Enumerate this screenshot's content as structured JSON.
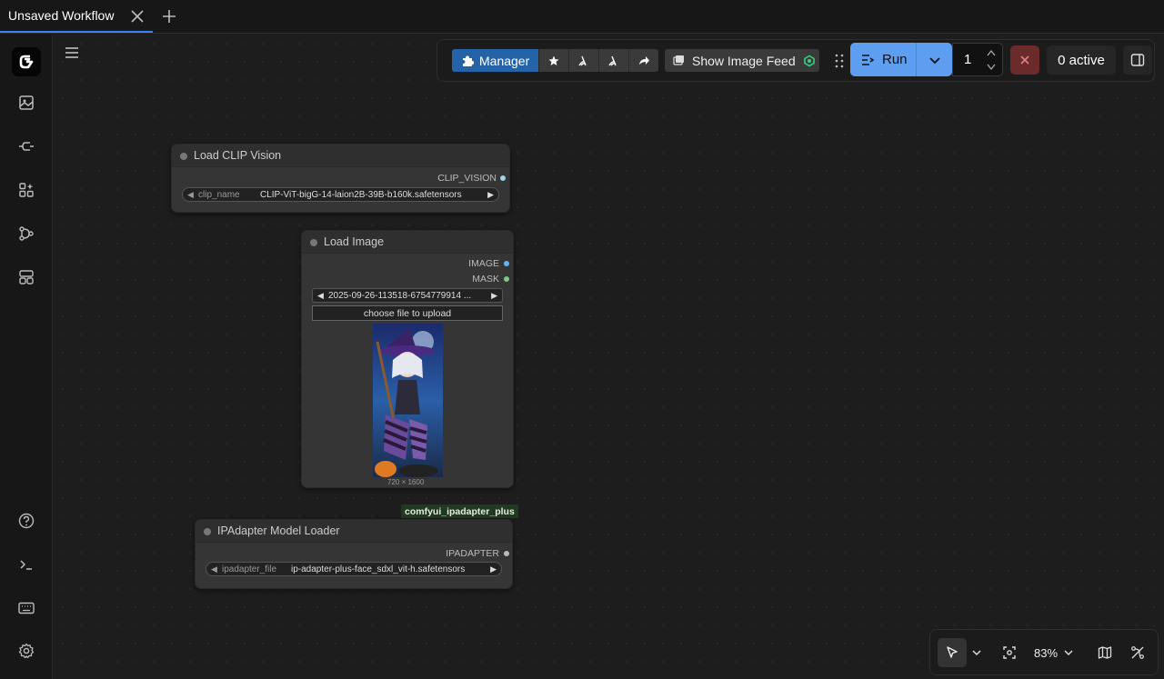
{
  "tab": {
    "title": "Unsaved Workflow"
  },
  "toolbar": {
    "manager_label": "Manager",
    "image_feed_label": "Show Image Feed",
    "run_label": "Run",
    "queue_count": "1",
    "active_label": "0 active"
  },
  "nodes": {
    "clip_vision": {
      "title": "Load CLIP Vision",
      "output": "CLIP_VISION",
      "widget_name": "clip_name",
      "widget_value": "CLIP-ViT-bigG-14-laion2B-39B-b160k.safetensors"
    },
    "load_image": {
      "title": "Load Image",
      "output_image": "IMAGE",
      "output_mask": "MASK",
      "file_value": "2025-09-26-113518-6754779914 ...",
      "upload_label": "choose file to upload",
      "image_size": "720 × 1600"
    },
    "ipadapter": {
      "pack_badge": "comfyui_ipadapter_plus",
      "title": "IPAdapter Model Loader",
      "output": "IPADAPTER",
      "widget_name": "ipadapter_file",
      "widget_value": "ip-adapter-plus-face_sdxl_vit-h.safetensors"
    }
  },
  "canvas_controls": {
    "zoom": "83%"
  },
  "colors": {
    "accent_blue": "#5e9ef0",
    "manager_blue": "#2563a8",
    "cancel_red": "#6b2b2b",
    "clip_dot": "#a1d6e6",
    "image_dot": "#64b5f6",
    "mask_dot": "#81c784",
    "ipadapter_dot": "#bbbbbb"
  }
}
